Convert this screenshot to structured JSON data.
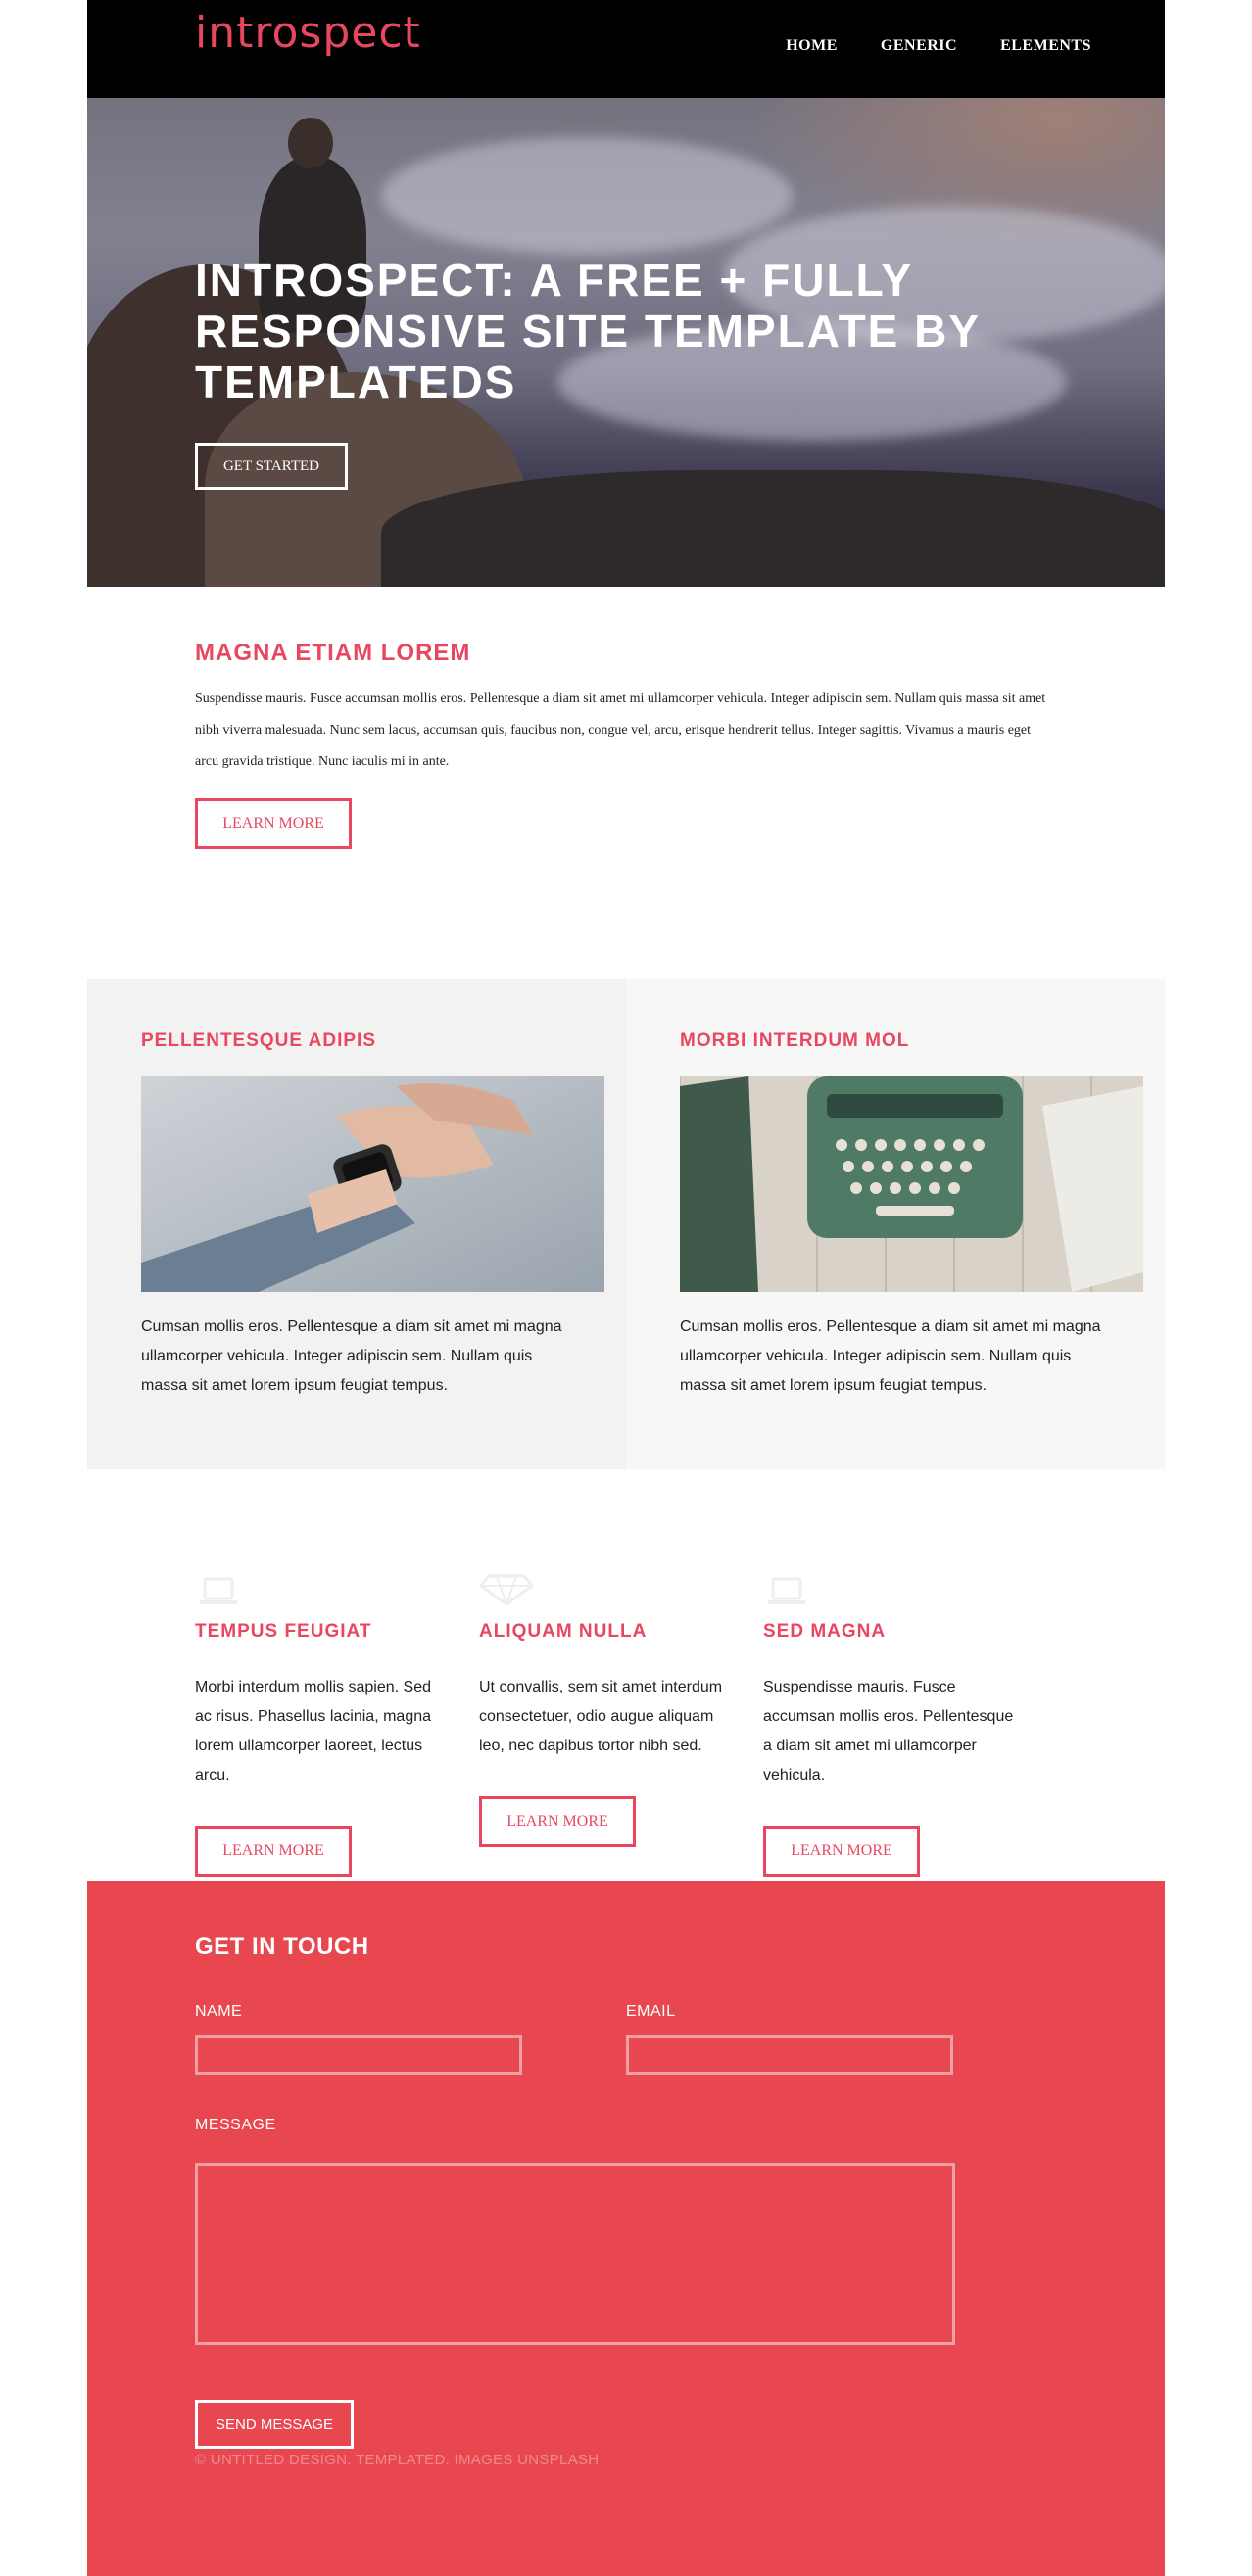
{
  "header": {
    "logo": "introspect",
    "nav": [
      "HOME",
      "GENERIC",
      "ELEMENTS"
    ]
  },
  "hero": {
    "title": "INTROSPECT: A FREE + FULLY RESPONSIVE SITE TEMPLATE BY TEMPLATEDS",
    "button": "GET STARTED"
  },
  "intro": {
    "title": "MAGNA ETIAM LOREM",
    "text": "Suspendisse mauris. Fusce accumsan mollis eros. Pellentesque a diam sit amet mi ullamcorper vehicula. Integer adipiscin sem. Nullam quis massa sit amet nibh viverra malesuada. Nunc sem lacus, accumsan quis, faucibus non, congue vel, arcu, erisque hendrerit tellus. Integer sagittis. Vivamus a mauris eget arcu gravida tristique. Nunc iaculis mi in ante.",
    "button": "LEARN MORE"
  },
  "columns": [
    {
      "title": "PELLENTESQUE ADIPIS",
      "image": "smartwatch-photo",
      "text": "Cumsan mollis eros. Pellentesque a diam sit amet mi magna ullamcorper vehicula. Integer adipiscin sem. Nullam quis massa sit amet lorem ipsum feugiat tempus."
    },
    {
      "title": "MORBI INTERDUM MOL",
      "image": "typewriter-photo",
      "text": "Cumsan mollis eros. Pellentesque a diam sit amet mi magna ullamcorper vehicula. Integer adipiscin sem. Nullam quis massa sit amet lorem ipsum feugiat tempus."
    }
  ],
  "features": [
    {
      "icon": "laptop-icon",
      "title": "TEMPUS FEUGIAT",
      "text": "Morbi interdum mollis sapien. Sed ac risus. Phasellus lacinia, magna lorem ullamcorper laoreet, lectus arcu.",
      "button": "LEARN MORE"
    },
    {
      "icon": "diamond-icon",
      "title": "ALIQUAM NULLA",
      "text": "Ut convallis, sem sit amet interdum consectetuer, odio augue aliquam leo, nec dapibus tortor nibh sed.",
      "button": "LEARN MORE"
    },
    {
      "icon": "laptop-icon",
      "title": "SED MAGNA",
      "text": "Suspendisse mauris. Fusce accumsan mollis eros. Pellentesque a diam sit amet mi ullamcorper vehicula.",
      "button": "LEARN MORE"
    }
  ],
  "contact": {
    "title": "GET IN TOUCH",
    "name_label": "NAME",
    "email_label": "EMAIL",
    "message_label": "MESSAGE",
    "send_button": "SEND MESSAGE",
    "copyright": "© UNTITLED DESIGN: TEMPLATED. IMAGES UNSPLASH"
  },
  "colors": {
    "accent": "#e8475f",
    "contact_bg": "#e8474f",
    "header_bg": "#000000"
  }
}
